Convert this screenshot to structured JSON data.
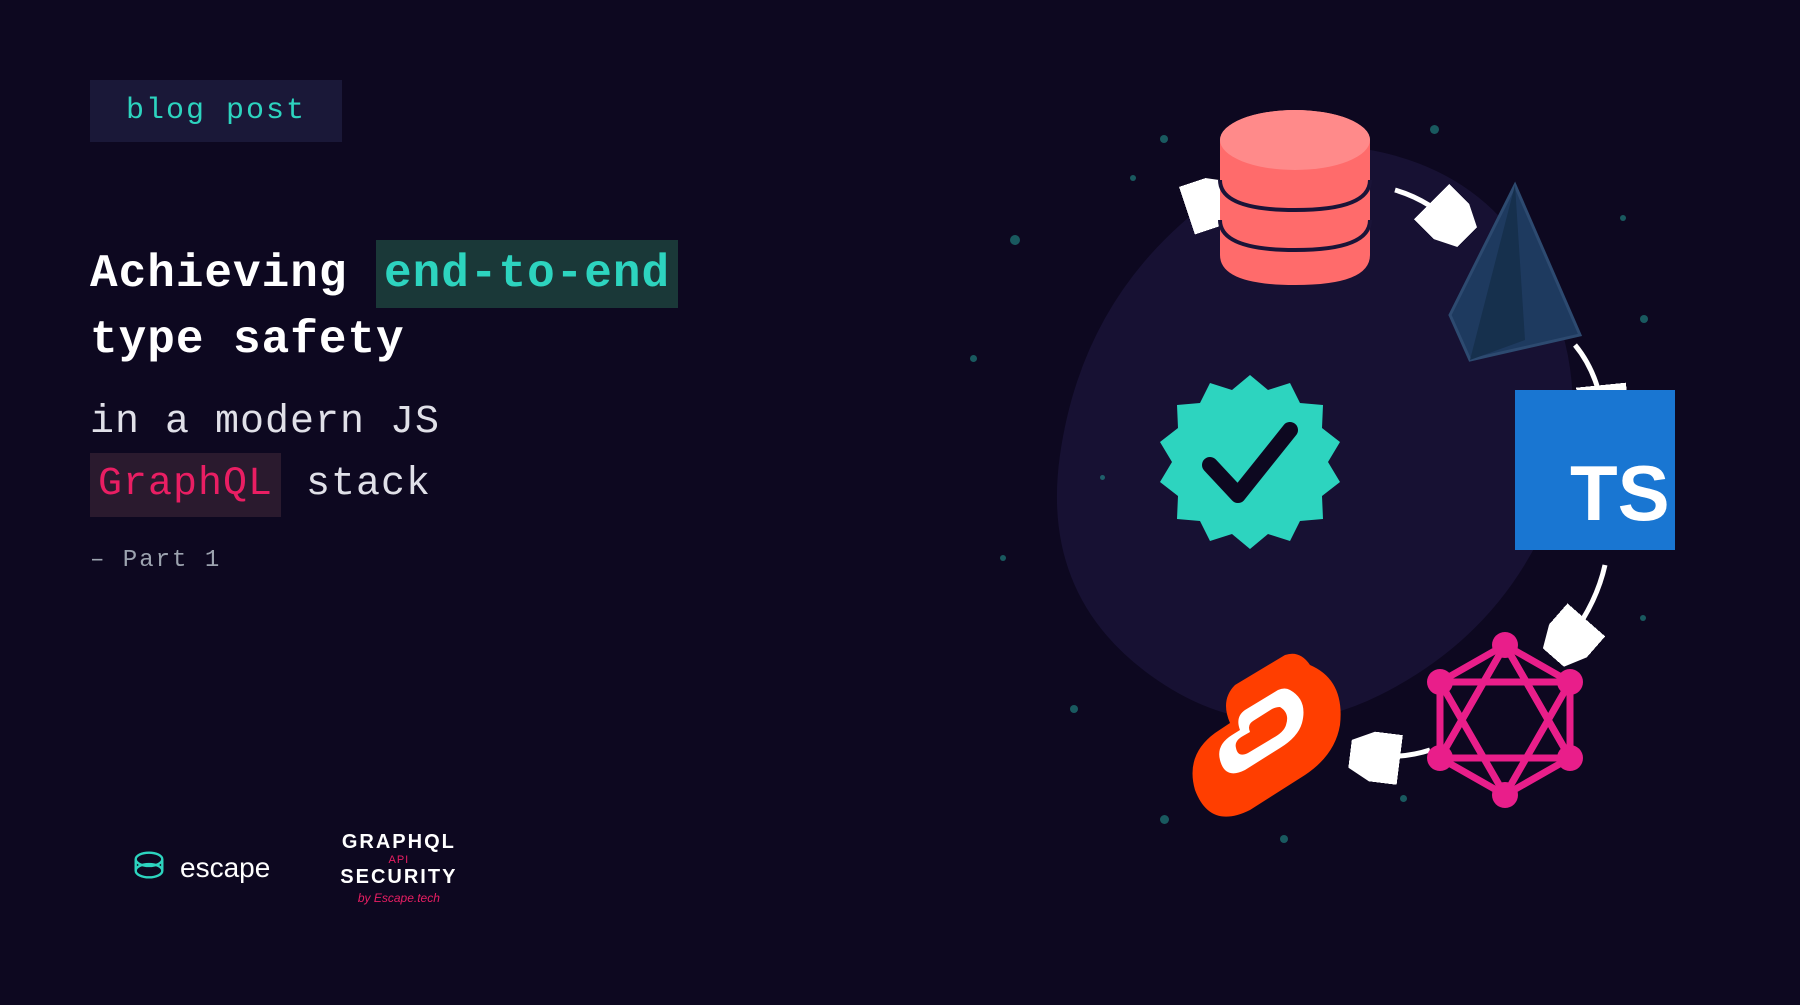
{
  "badge": {
    "label": "blog post"
  },
  "headline": {
    "line1_prefix": "Achieving ",
    "line1_highlight": "end-to-end",
    "line2": "type safety",
    "subtitle_line1": "in a modern JS",
    "subtitle_highlight": "GraphQL",
    "subtitle_suffix": " stack",
    "part": "– Part 1"
  },
  "brands": {
    "escape": {
      "name": "escape"
    },
    "graphql_security": {
      "line1": "GRAPHQL",
      "api": "API",
      "line2": "SECURITY",
      "by": "by Escape.tech"
    }
  },
  "illustration": {
    "icons": {
      "database": "database-icon",
      "prisma": "prisma-icon",
      "typescript": "TS",
      "graphql": "graphql-icon",
      "svelte": "svelte-icon",
      "check": "check-badge"
    }
  },
  "colors": {
    "background": "#0d0820",
    "teal": "#2dd4bf",
    "pink": "#e91e63",
    "coral": "#ff6b6b",
    "ts_blue": "#1976d2",
    "svelte_orange": "#ff3e00"
  }
}
